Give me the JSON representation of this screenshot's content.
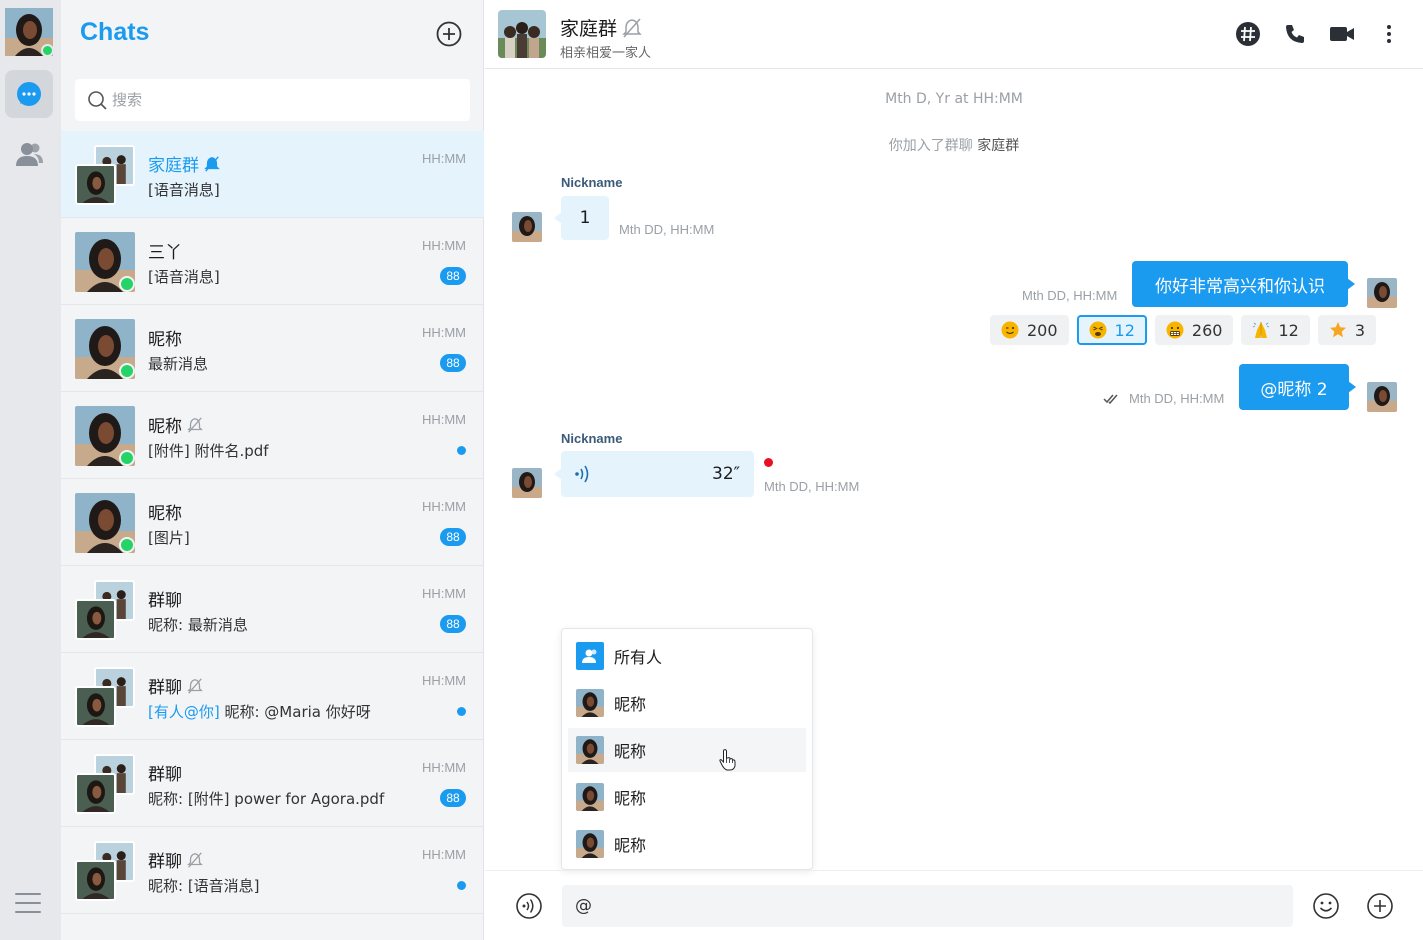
{
  "sidebar": {
    "nav": [
      {
        "name": "chats",
        "icon": "chat-bubble-icon",
        "active": true
      },
      {
        "name": "contacts",
        "icon": "contacts-icon",
        "active": false
      }
    ],
    "menu_icon": "menu-icon"
  },
  "chat_list": {
    "title": "Chats",
    "add_icon": "plus-circle-icon",
    "search_placeholder": "搜索",
    "items": [
      {
        "name": "家庭群",
        "preview": "[语音消息]",
        "time": "HH:MM",
        "group": true,
        "muted": true,
        "active": true
      },
      {
        "name": "三丫",
        "preview": "[语音消息]",
        "time": "HH:MM",
        "badge": "88",
        "online": true
      },
      {
        "name": "昵称",
        "preview": "最新消息",
        "time": "HH:MM",
        "badge": "88",
        "online": true
      },
      {
        "name": "昵称",
        "preview": "[附件] 附件名.pdf",
        "time": "HH:MM",
        "muted": true,
        "dot": true,
        "online": true
      },
      {
        "name": "昵称",
        "preview": "[图片]",
        "time": "HH:MM",
        "badge": "88",
        "online": true
      },
      {
        "name": "群聊",
        "preview": "昵称: 最新消息",
        "time": "HH:MM",
        "badge": "88",
        "group": true
      },
      {
        "name": "群聊",
        "mention": "[有人@你]",
        "preview": " 昵称: @Maria 你好呀",
        "time": "HH:MM",
        "muted": true,
        "dot": true,
        "group": true
      },
      {
        "name": "群聊",
        "preview": "昵称: [附件] power for Agora.pdf",
        "time": "HH:MM",
        "badge": "88",
        "group": true
      },
      {
        "name": "群聊",
        "preview": "昵称: [语音消息]",
        "time": "HH:MM",
        "muted": true,
        "dot": true,
        "group": true
      }
    ]
  },
  "conversation": {
    "title": "家庭群",
    "subtitle": "相亲相爱一家人",
    "header_icons": [
      "hashtag-icon",
      "phone-icon",
      "video-camera-icon",
      "more-vertical-icon"
    ],
    "date_line": "Mth D, Yr at HH:MM",
    "system_prefix": "你加入了群聊",
    "system_group": "家庭群",
    "messages": [
      {
        "nick": "Nickname",
        "text": "1",
        "time": "Mth DD, HH:MM"
      },
      {
        "text": "你好非常高兴和你认识",
        "time": "Mth DD, HH:MM"
      },
      {
        "text": "@昵称 2",
        "time": "Mth DD, HH:MM"
      },
      {
        "nick": "Nickname",
        "duration": "32″",
        "time": "Mth DD, HH:MM"
      }
    ],
    "reactions": [
      {
        "emoji": "wink-emoji-icon",
        "count": "200",
        "color": "#f7b500"
      },
      {
        "emoji": "tired-emoji-icon",
        "count": "12",
        "selected": true,
        "color": "#f7b500"
      },
      {
        "emoji": "grimace-emoji-icon",
        "count": "260",
        "color": "#f7b500"
      },
      {
        "emoji": "pray-emoji-icon",
        "count": "12",
        "color": "#f7b500"
      },
      {
        "emoji": "star-emoji-icon",
        "count": "3",
        "color": "#f5a623"
      }
    ]
  },
  "mention_popup": {
    "items": [
      "所有人",
      "昵称",
      "昵称",
      "昵称",
      "昵称"
    ]
  },
  "composer": {
    "value": "@",
    "icons": [
      "voice-icon",
      "emoji-icon",
      "plus-icon"
    ]
  },
  "colors": {
    "accent": "#1a9bf0",
    "online": "#25d366",
    "unread_red": "#e81123"
  }
}
